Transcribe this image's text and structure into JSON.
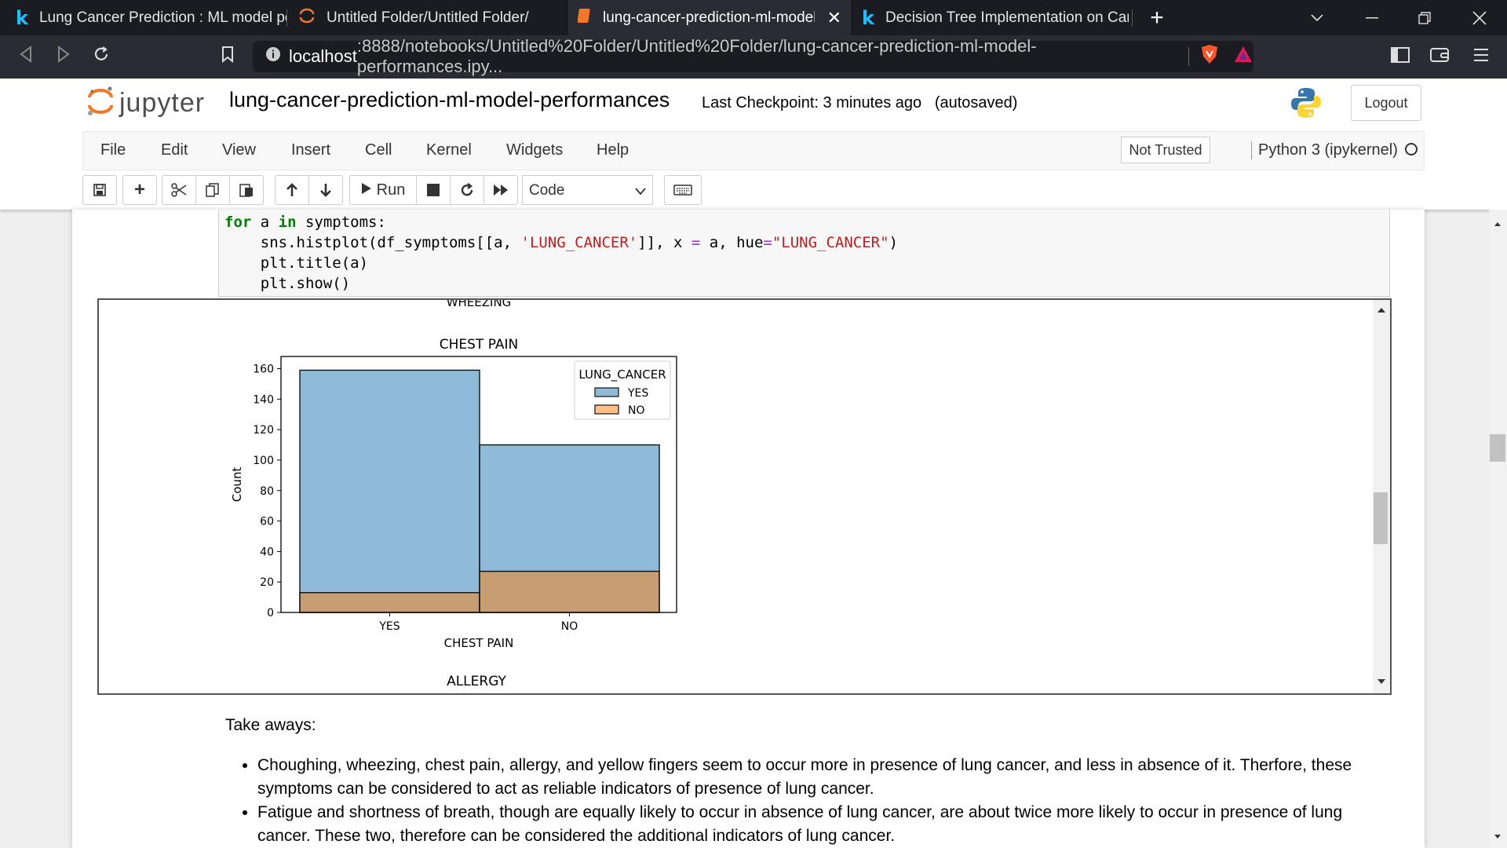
{
  "browser": {
    "tabs": [
      {
        "title": "Lung Cancer Prediction : ML model pe"
      },
      {
        "title": "Untitled Folder/Untitled Folder/"
      },
      {
        "title": "lung-cancer-prediction-ml-model-"
      },
      {
        "title": "Decision Tree Implementation on Canc"
      }
    ],
    "new_tab": "+",
    "url_host": "localhost",
    "url_path": ":8888/notebooks/Untitled%20Folder/Untitled%20Folder/lung-cancer-prediction-ml-model-performances.ipy..."
  },
  "jupyter": {
    "logo_text": "jupyter",
    "notebook_name": "lung-cancer-prediction-ml-model-performances",
    "checkpoint": "Last Checkpoint: 3 minutes ago",
    "autosaved": "(autosaved)",
    "logout": "Logout",
    "menu": [
      "File",
      "Edit",
      "View",
      "Insert",
      "Cell",
      "Kernel",
      "Widgets",
      "Help"
    ],
    "not_trusted": "Not Trusted",
    "kernel": "Python 3 (ipykernel)",
    "toolbar": {
      "run": "Run",
      "cell_type": "Code"
    }
  },
  "code": {
    "line1_kw": "for",
    "line1_a": " a ",
    "line1_in": "in",
    "line1_rest": " symptoms:",
    "line2_a": "    sns.histplot(df_symptoms[[a, ",
    "line2_str": "'LUNG_CANCER'",
    "line2_b": "]], x ",
    "line2_eq": "=",
    "line2_c": " a, hue",
    "line2_eq2": "=",
    "line2_str2": "\"LUNG_CANCER\"",
    "line2_d": ")",
    "line3": "    plt.title(a)",
    "line4": "    plt.show()"
  },
  "output": {
    "prev_title": "WHEEZING",
    "next_title": "ALLERGY"
  },
  "chart_data": {
    "type": "bar",
    "title": "CHEST PAIN",
    "xlabel": "CHEST PAIN",
    "ylabel": "Count",
    "categories": [
      "YES",
      "NO"
    ],
    "series": [
      {
        "name": "YES",
        "values": [
          159,
          110
        ],
        "color": "#1f77b4"
      },
      {
        "name": "NO",
        "values": [
          13,
          27
        ],
        "color": "#ff7f0e"
      }
    ],
    "ylim": [
      0,
      168
    ],
    "yticks": [
      0,
      20,
      40,
      60,
      80,
      100,
      120,
      140,
      160
    ],
    "legend_title": "LUNG_CANCER",
    "legend_position": "top-right",
    "grid": false
  },
  "notes": {
    "heading": "Take aways:",
    "bullets": [
      "Choughing, wheezing, chest pain, allergy, and yellow fingers seem to occur more in presence of lung cancer, and less in absence of it. Therfore, these symptoms can be considered to act as reliable indicators of presence of lung cancer.",
      "Fatigue and shortness of breath, though are equally likely to occur in absence of lung cancer, are about twice more likely to occur in presence of lung cancer. These two, therefore can be considered the additional indicators of lung cancer."
    ]
  }
}
